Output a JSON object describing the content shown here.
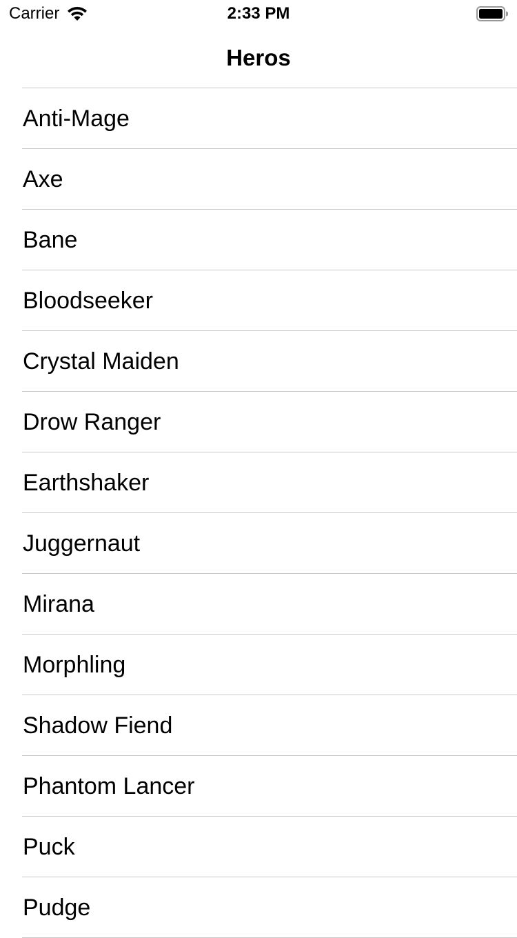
{
  "status_bar": {
    "carrier": "Carrier",
    "time": "2:33 PM",
    "wifi_icon": "wifi-icon",
    "battery_icon": "battery-icon"
  },
  "nav": {
    "title": "Heros"
  },
  "heroes": [
    {
      "name": "Anti-Mage"
    },
    {
      "name": "Axe"
    },
    {
      "name": "Bane"
    },
    {
      "name": "Bloodseeker"
    },
    {
      "name": "Crystal Maiden"
    },
    {
      "name": "Drow Ranger"
    },
    {
      "name": "Earthshaker"
    },
    {
      "name": "Juggernaut"
    },
    {
      "name": "Mirana"
    },
    {
      "name": "Morphling"
    },
    {
      "name": "Shadow Fiend"
    },
    {
      "name": "Phantom Lancer"
    },
    {
      "name": "Puck"
    },
    {
      "name": "Pudge"
    }
  ],
  "colors": {
    "background": "#ffffff",
    "text": "#000000",
    "separator": "#c8c7cc"
  }
}
